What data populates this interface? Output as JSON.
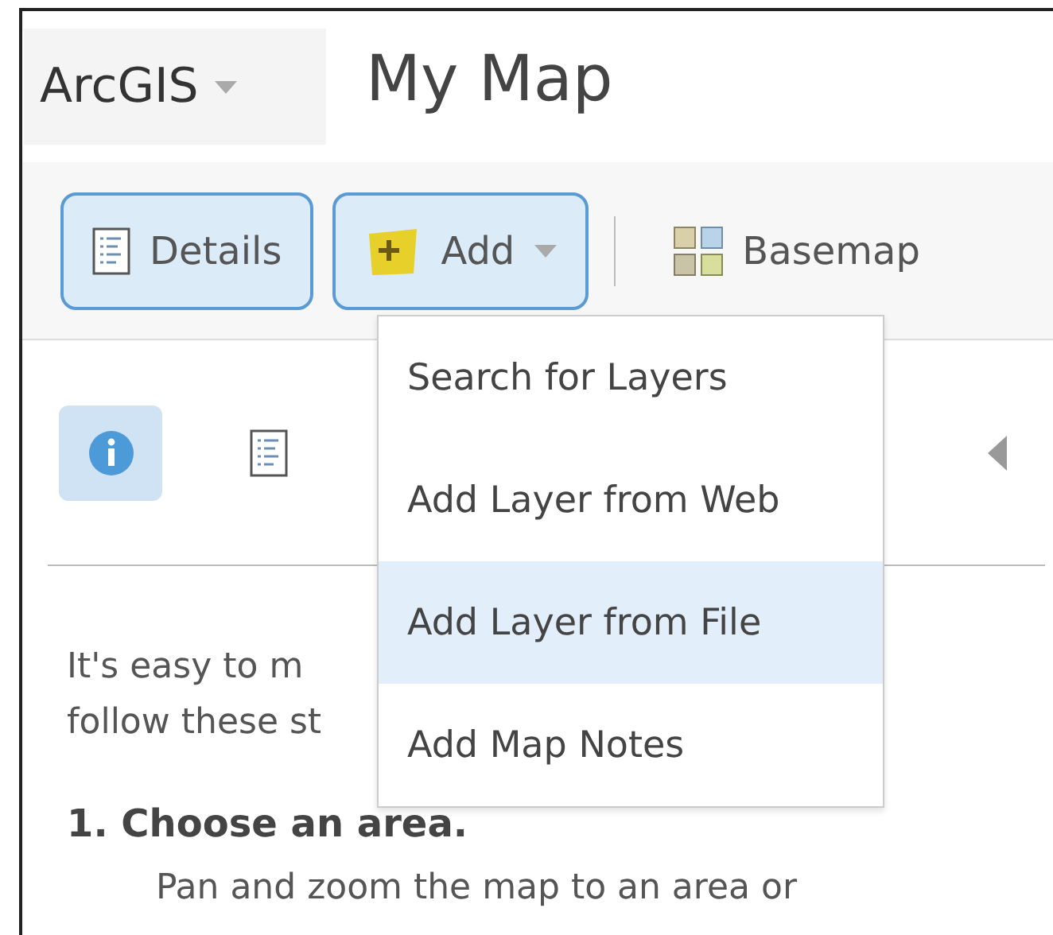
{
  "header": {
    "app_menu": "ArcGIS",
    "title": "My Map"
  },
  "toolbar": {
    "buttons": [
      {
        "kind": "details",
        "label": "Details",
        "active": true,
        "dropdown": false
      },
      {
        "kind": "add",
        "label": "Add",
        "active": true,
        "dropdown": true
      },
      {
        "kind": "basemap",
        "label": "Basemap",
        "active": false,
        "dropdown": false
      }
    ]
  },
  "panel": {
    "tabs": [
      {
        "kind": "info",
        "selected": true
      },
      {
        "kind": "details",
        "selected": false
      }
    ],
    "intro_lines": [
      "It's easy to m",
      "follow these st"
    ],
    "step": {
      "heading": "1. Choose an area.",
      "text": "Pan and zoom the map to an area or"
    }
  },
  "add_menu": {
    "items": [
      {
        "label": "Search for Layers",
        "selected": false
      },
      {
        "label": "Add Layer from Web",
        "selected": false
      },
      {
        "label": "Add Layer from File",
        "selected": true
      },
      {
        "label": "Add Map Notes",
        "selected": false
      }
    ]
  }
}
